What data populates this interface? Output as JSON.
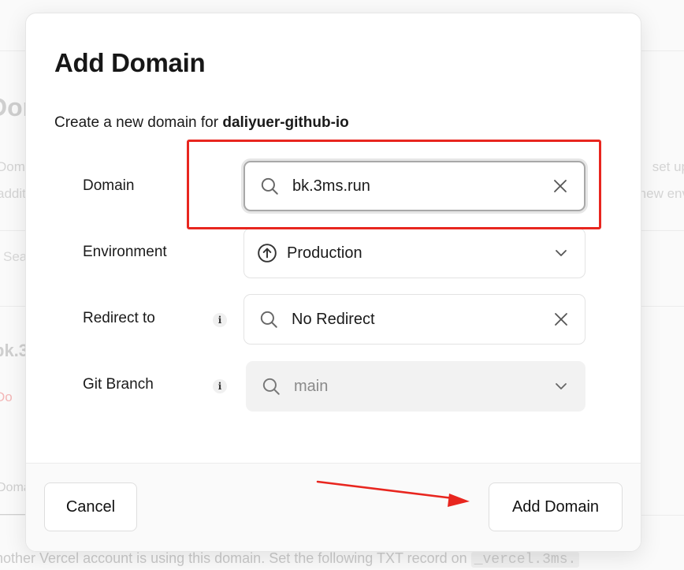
{
  "background": {
    "heading": "Doma",
    "p1": "Domains",
    "p2": "additional",
    "right1": "set up",
    "right2": "new env",
    "search_placeholder": "Sea",
    "domain_name": "bk.3r",
    "warning": "Do",
    "tab": "Doma",
    "bottom_text": "nother Vercel account is using this domain. Set the following TXT record on",
    "bottom_code": "_vercel.3ms."
  },
  "modal": {
    "title": "Add Domain",
    "subtitle_prefix": "Create a new domain for",
    "project_name": "daliyuer-github-io",
    "rows": {
      "domain": {
        "label": "Domain",
        "value": "bk.3ms.run"
      },
      "environment": {
        "label": "Environment",
        "value": "Production"
      },
      "redirect": {
        "label": "Redirect to",
        "value": "No Redirect"
      },
      "git_branch": {
        "label": "Git Branch",
        "value": "main"
      }
    },
    "cancel_label": "Cancel",
    "submit_label": "Add Domain"
  },
  "icons": {
    "search": "search-icon",
    "clear": "close-icon",
    "production": "arrow-up-circle-icon",
    "chevron": "chevron-down-icon",
    "info": "info-icon"
  },
  "colors": {
    "annotation": "#e8261f",
    "text": "#171717",
    "muted": "#8a8a8a"
  }
}
